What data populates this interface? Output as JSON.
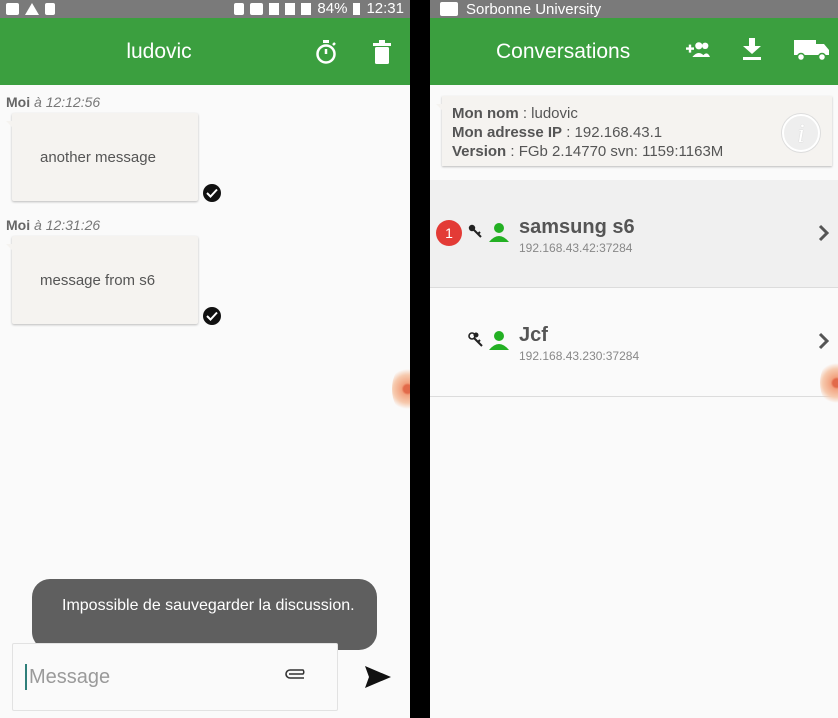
{
  "left": {
    "status": {
      "battery": "84%",
      "time": "12:31"
    },
    "appbar": {
      "title": "ludovic",
      "timer_icon": "stopwatch-icon",
      "delete_icon": "trash-icon"
    },
    "messages": [
      {
        "sender": "Moi",
        "prefix": "à",
        "time": "12:12:56",
        "text": "another message"
      },
      {
        "sender": "Moi",
        "prefix": "à",
        "time": "12:31:26",
        "text": "message from s6"
      }
    ],
    "toast": "Impossible de sauvegarder la discussion.",
    "composer": {
      "placeholder": "Message",
      "attach_icon": "paperclip-icon",
      "send_icon": "send-icon"
    }
  },
  "right": {
    "status": {
      "carrier": "Sorbonne University"
    },
    "appbar": {
      "title": "Conversations",
      "icons": [
        "add-group-icon",
        "download-icon",
        "truck-icon"
      ]
    },
    "info": {
      "name_label": "Mon nom",
      "name_value": " : ludovic",
      "ip_label": "Mon adresse IP",
      "ip_value": " : 192.168.43.1",
      "version_label": "Version",
      "version_value": " : FGb 2.14770 svn: 1159:1163M"
    },
    "conversations": [
      {
        "badge": "1",
        "name": "samsung s6",
        "address": "192.168.43.42:37284"
      },
      {
        "badge": "",
        "name": "Jcf",
        "address": "192.168.43.230:37284"
      }
    ]
  },
  "colors": {
    "primary": "#3b9f3f",
    "badge": "#e33b36",
    "status": "#7a7a7a"
  }
}
